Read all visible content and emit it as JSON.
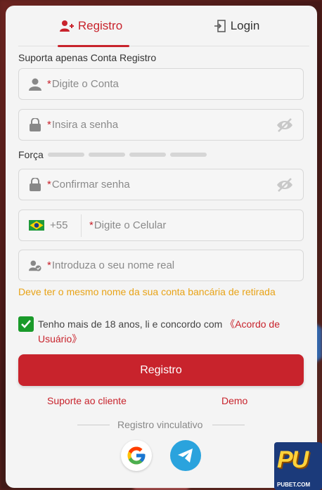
{
  "tabs": {
    "register": "Registro",
    "login": "Login"
  },
  "support_label": "Suporta apenas Conta Registro",
  "fields": {
    "account_placeholder": "Digite o Conta",
    "password_placeholder": "Insira a senha",
    "confirm_placeholder": "Confirmar senha",
    "phone_code": "+55",
    "phone_placeholder": "Digite o Celular",
    "name_placeholder": "Introduza o seu nome real",
    "required_mark": "*"
  },
  "strength_label": "Força",
  "name_hint": "Deve ter o mesmo nome da sua conta bancária de retirada",
  "terms": {
    "text": "Tenho mais de 18 anos, li e concordo com ",
    "link": "《Acordo de Usuário》",
    "checked": true
  },
  "register_button": "Registro",
  "links": {
    "support": "Suporte ao cliente",
    "demo": "Demo"
  },
  "divider_text": "Registro vinculativo",
  "social": [
    "google-icon",
    "telegram-icon"
  ],
  "logo": {
    "main": "PU",
    "sub": "PUBET.COM"
  },
  "colors": {
    "accent": "#c8232c",
    "hint": "#e8a317",
    "check": "#1a9a2a",
    "telegram": "#2aa3dd"
  }
}
